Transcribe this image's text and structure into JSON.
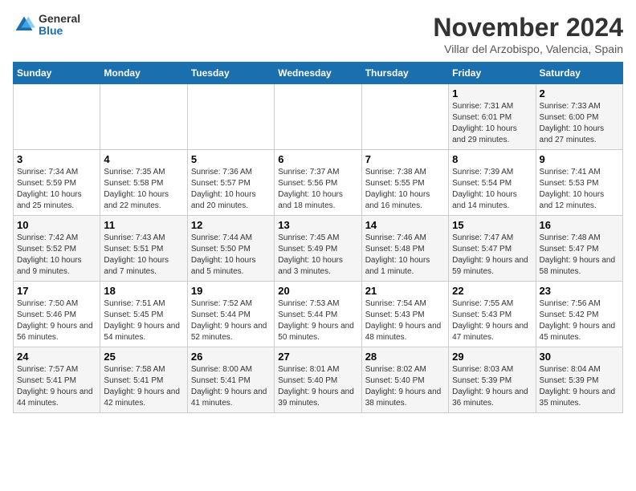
{
  "header": {
    "logo_general": "General",
    "logo_blue": "Blue",
    "month_title": "November 2024",
    "location": "Villar del Arzobispo, Valencia, Spain"
  },
  "days_of_week": [
    "Sunday",
    "Monday",
    "Tuesday",
    "Wednesday",
    "Thursday",
    "Friday",
    "Saturday"
  ],
  "weeks": [
    [
      {
        "day": "",
        "info": ""
      },
      {
        "day": "",
        "info": ""
      },
      {
        "day": "",
        "info": ""
      },
      {
        "day": "",
        "info": ""
      },
      {
        "day": "",
        "info": ""
      },
      {
        "day": "1",
        "info": "Sunrise: 7:31 AM\nSunset: 6:01 PM\nDaylight: 10 hours and 29 minutes."
      },
      {
        "day": "2",
        "info": "Sunrise: 7:33 AM\nSunset: 6:00 PM\nDaylight: 10 hours and 27 minutes."
      }
    ],
    [
      {
        "day": "3",
        "info": "Sunrise: 7:34 AM\nSunset: 5:59 PM\nDaylight: 10 hours and 25 minutes."
      },
      {
        "day": "4",
        "info": "Sunrise: 7:35 AM\nSunset: 5:58 PM\nDaylight: 10 hours and 22 minutes."
      },
      {
        "day": "5",
        "info": "Sunrise: 7:36 AM\nSunset: 5:57 PM\nDaylight: 10 hours and 20 minutes."
      },
      {
        "day": "6",
        "info": "Sunrise: 7:37 AM\nSunset: 5:56 PM\nDaylight: 10 hours and 18 minutes."
      },
      {
        "day": "7",
        "info": "Sunrise: 7:38 AM\nSunset: 5:55 PM\nDaylight: 10 hours and 16 minutes."
      },
      {
        "day": "8",
        "info": "Sunrise: 7:39 AM\nSunset: 5:54 PM\nDaylight: 10 hours and 14 minutes."
      },
      {
        "day": "9",
        "info": "Sunrise: 7:41 AM\nSunset: 5:53 PM\nDaylight: 10 hours and 12 minutes."
      }
    ],
    [
      {
        "day": "10",
        "info": "Sunrise: 7:42 AM\nSunset: 5:52 PM\nDaylight: 10 hours and 9 minutes."
      },
      {
        "day": "11",
        "info": "Sunrise: 7:43 AM\nSunset: 5:51 PM\nDaylight: 10 hours and 7 minutes."
      },
      {
        "day": "12",
        "info": "Sunrise: 7:44 AM\nSunset: 5:50 PM\nDaylight: 10 hours and 5 minutes."
      },
      {
        "day": "13",
        "info": "Sunrise: 7:45 AM\nSunset: 5:49 PM\nDaylight: 10 hours and 3 minutes."
      },
      {
        "day": "14",
        "info": "Sunrise: 7:46 AM\nSunset: 5:48 PM\nDaylight: 10 hours and 1 minute."
      },
      {
        "day": "15",
        "info": "Sunrise: 7:47 AM\nSunset: 5:47 PM\nDaylight: 9 hours and 59 minutes."
      },
      {
        "day": "16",
        "info": "Sunrise: 7:48 AM\nSunset: 5:47 PM\nDaylight: 9 hours and 58 minutes."
      }
    ],
    [
      {
        "day": "17",
        "info": "Sunrise: 7:50 AM\nSunset: 5:46 PM\nDaylight: 9 hours and 56 minutes."
      },
      {
        "day": "18",
        "info": "Sunrise: 7:51 AM\nSunset: 5:45 PM\nDaylight: 9 hours and 54 minutes."
      },
      {
        "day": "19",
        "info": "Sunrise: 7:52 AM\nSunset: 5:44 PM\nDaylight: 9 hours and 52 minutes."
      },
      {
        "day": "20",
        "info": "Sunrise: 7:53 AM\nSunset: 5:44 PM\nDaylight: 9 hours and 50 minutes."
      },
      {
        "day": "21",
        "info": "Sunrise: 7:54 AM\nSunset: 5:43 PM\nDaylight: 9 hours and 48 minutes."
      },
      {
        "day": "22",
        "info": "Sunrise: 7:55 AM\nSunset: 5:43 PM\nDaylight: 9 hours and 47 minutes."
      },
      {
        "day": "23",
        "info": "Sunrise: 7:56 AM\nSunset: 5:42 PM\nDaylight: 9 hours and 45 minutes."
      }
    ],
    [
      {
        "day": "24",
        "info": "Sunrise: 7:57 AM\nSunset: 5:41 PM\nDaylight: 9 hours and 44 minutes."
      },
      {
        "day": "25",
        "info": "Sunrise: 7:58 AM\nSunset: 5:41 PM\nDaylight: 9 hours and 42 minutes."
      },
      {
        "day": "26",
        "info": "Sunrise: 8:00 AM\nSunset: 5:41 PM\nDaylight: 9 hours and 41 minutes."
      },
      {
        "day": "27",
        "info": "Sunrise: 8:01 AM\nSunset: 5:40 PM\nDaylight: 9 hours and 39 minutes."
      },
      {
        "day": "28",
        "info": "Sunrise: 8:02 AM\nSunset: 5:40 PM\nDaylight: 9 hours and 38 minutes."
      },
      {
        "day": "29",
        "info": "Sunrise: 8:03 AM\nSunset: 5:39 PM\nDaylight: 9 hours and 36 minutes."
      },
      {
        "day": "30",
        "info": "Sunrise: 8:04 AM\nSunset: 5:39 PM\nDaylight: 9 hours and 35 minutes."
      }
    ]
  ]
}
